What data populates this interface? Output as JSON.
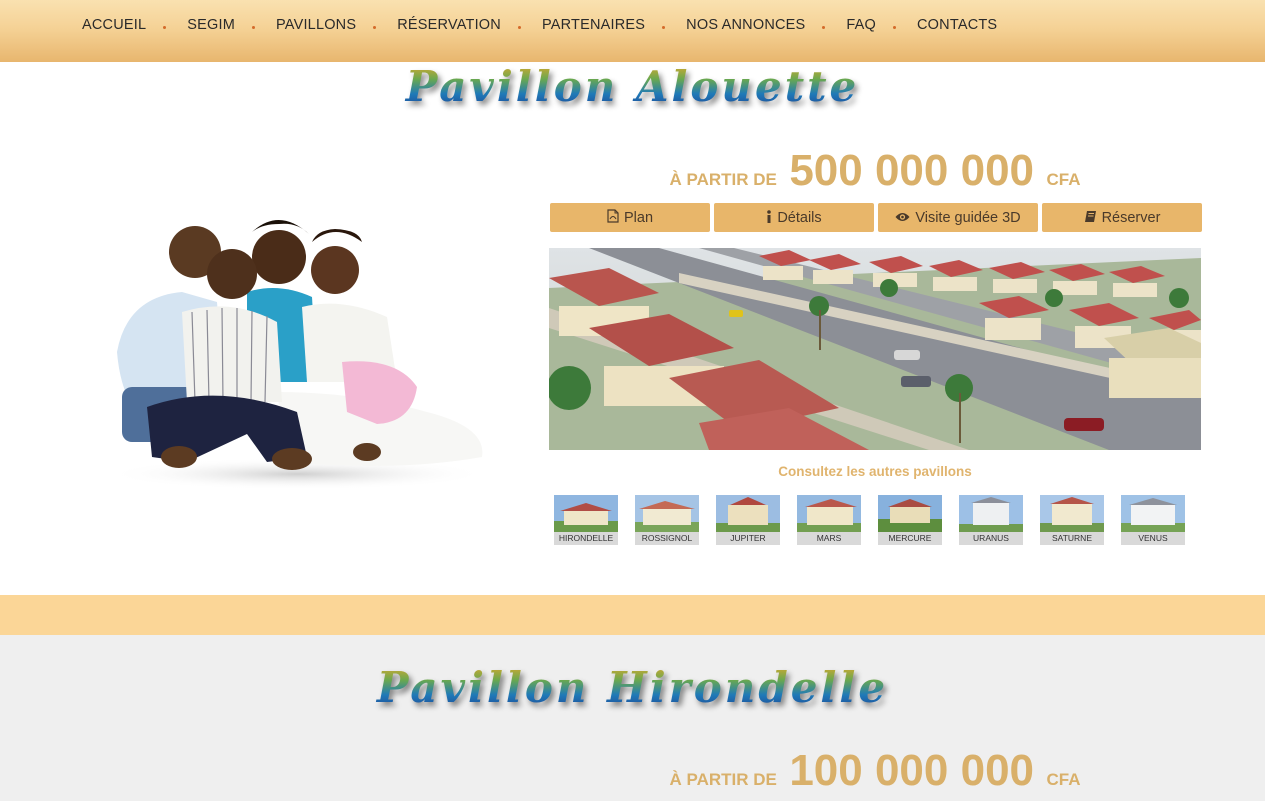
{
  "nav": {
    "items": [
      {
        "label": "ACCUEIL"
      },
      {
        "label": "SEGIM"
      },
      {
        "label": "PAVILLONS"
      },
      {
        "label": "RÉSERVATION"
      },
      {
        "label": "PARTENAIRES"
      },
      {
        "label": "NOS ANNONCES"
      },
      {
        "label": "FAQ"
      },
      {
        "label": "CONTACTS"
      }
    ]
  },
  "section1": {
    "title": "Pavillon Alouette",
    "price_prefix": "À PARTIR DE",
    "price_amount": "500 000 000",
    "price_currency": "CFA",
    "buttons": [
      {
        "label": "Plan",
        "icon": "file-pdf-icon"
      },
      {
        "label": "Détails",
        "icon": "info-icon"
      },
      {
        "label": "Visite guidée 3D",
        "icon": "eye-icon"
      },
      {
        "label": "Réserver",
        "icon": "book-icon"
      }
    ],
    "consult_label": "Consultez les autres pavillons",
    "thumbnails": [
      {
        "label": "HIRONDELLE"
      },
      {
        "label": "ROSSIGNOL"
      },
      {
        "label": "JUPITER"
      },
      {
        "label": "MARS"
      },
      {
        "label": "MERCURE"
      },
      {
        "label": "URANUS"
      },
      {
        "label": "SATURNE"
      },
      {
        "label": "VENUS"
      }
    ]
  },
  "section2": {
    "title": "Pavillon Hirondelle",
    "price_prefix": "À PARTIR DE",
    "price_amount": "100 000 000",
    "price_currency": "CFA"
  },
  "colors": {
    "nav_gradient_top": "#f9e1b0",
    "nav_gradient_bottom": "#e8b66e",
    "accent": "#e8b66a",
    "price_text": "#d9b06a",
    "band": "#fbd697",
    "section2_bg": "#efefef"
  }
}
